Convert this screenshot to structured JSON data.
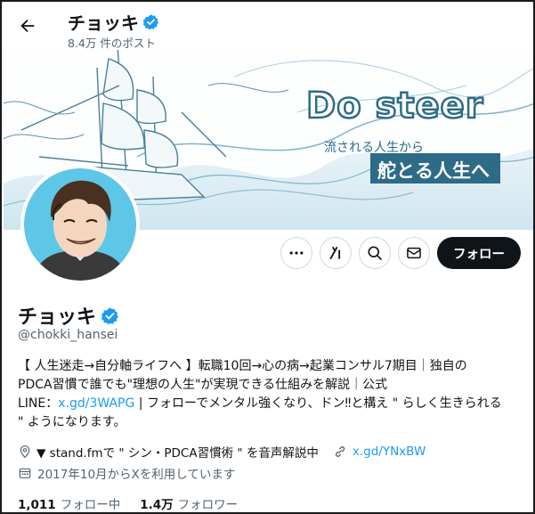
{
  "header": {
    "back_icon": "arrow-left-icon",
    "name": "チョッキ",
    "post_count": "8.4万 件のポスト"
  },
  "banner": {
    "title": "Do steer",
    "line1": "流される人生から",
    "line2": "舵とる人生へ"
  },
  "actions": {
    "more_icon": "more-horizontal-icon",
    "grok_icon": "grok-icon",
    "search_icon": "search-icon",
    "message_icon": "envelope-icon",
    "follow_label": "フォロー"
  },
  "profile": {
    "name": "チョッキ",
    "handle": "@chokki_hansei",
    "verified_color": "#1d9bf0",
    "bio_line1": "【 人生迷走→自分軸ライフへ 】転職10回→心の病→起業コンサル7期目｜独自の",
    "bio_line2": "PDCA習慣で誰でも\"理想の人生\"が実現できる仕組みを解説｜公式",
    "bio_line3_prefix": "LINE：",
    "bio_link": "x.gd/3WAPG",
    "bio_line3_suffix": " | フォローでメンタル強くなり、ドン‼と構え \" らしく生きられる",
    "bio_line4": "\" ようになります。",
    "location": "▼ stand.fmで \" シン・PDCA習慣術 \" を音声解説中",
    "website": "x.gd/YNxBW",
    "joined": "2017年10月からXを利用しています",
    "following_count": "1,011",
    "following_label": "フォロー中",
    "followers_count": "1.4万",
    "followers_label": "フォロワー"
  }
}
